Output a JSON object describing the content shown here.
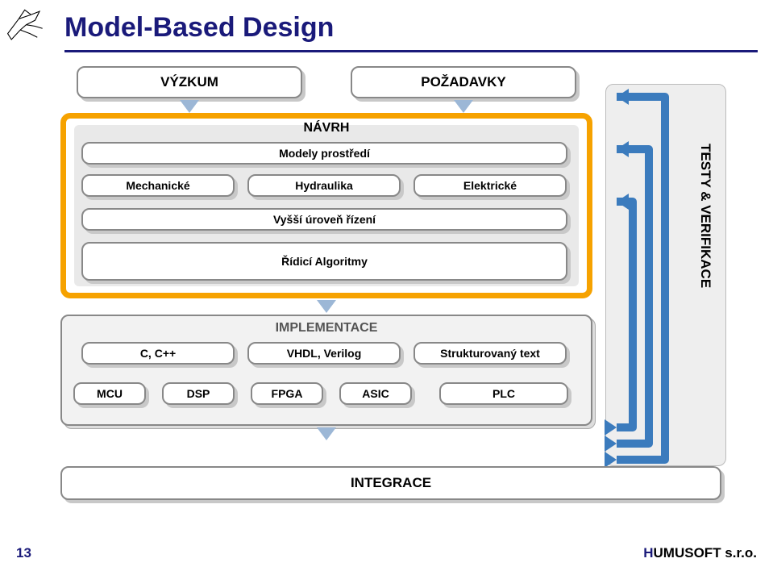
{
  "title": "Model-Based Design",
  "page_number": "13",
  "footer": {
    "company": "HUMUSOFT s.r.o."
  },
  "top": {
    "vyzkum": "VÝZKUM",
    "pozadavky": "POŽADAVKY"
  },
  "navrh": {
    "title": "NÁVRH",
    "modely": "Modely prostředí",
    "mech": "Mechanické",
    "hydr": "Hydraulika",
    "elek": "Elektrické",
    "vyssi": "Vyšší úroveň řízení",
    "ridici": "Řídicí Algoritmy"
  },
  "impl": {
    "title": "IMPLEMENTACE",
    "ccpp": "C, C++",
    "vhdl": "VHDL, Verilog",
    "stext": "Strukturovaný text",
    "mcu": "MCU",
    "dsp": "DSP",
    "fpga": "FPGA",
    "asic": "ASIC",
    "plc": "PLC"
  },
  "integrace": "INTEGRACE",
  "verif": "TESTY & VERIFIKACE"
}
